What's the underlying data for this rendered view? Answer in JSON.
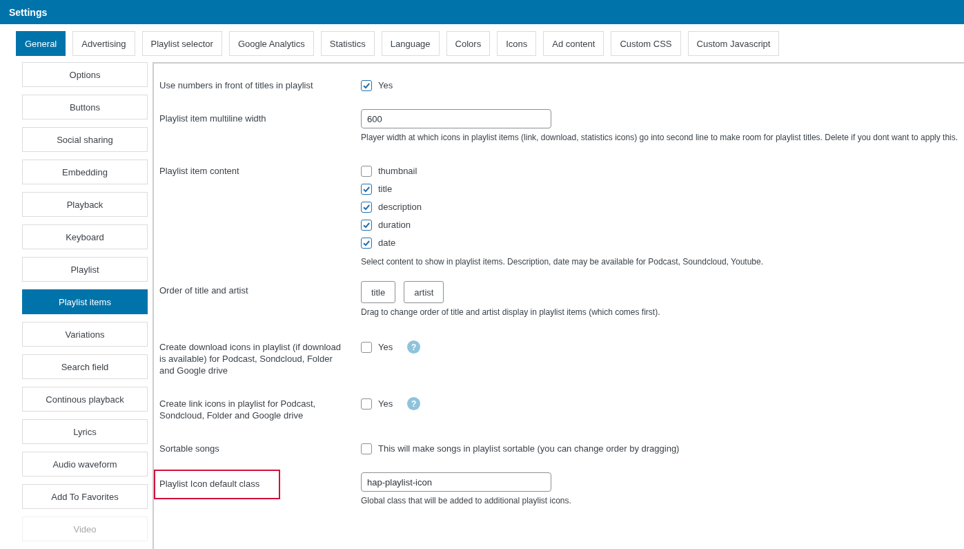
{
  "window": {
    "title": "Settings"
  },
  "tabs": [
    {
      "label": "General",
      "selected": true
    },
    {
      "label": "Advertising",
      "selected": false
    },
    {
      "label": "Playlist selector",
      "selected": false
    },
    {
      "label": "Google Analytics",
      "selected": false
    },
    {
      "label": "Statistics",
      "selected": false
    },
    {
      "label": "Language",
      "selected": false
    },
    {
      "label": "Colors",
      "selected": false
    },
    {
      "label": "Icons",
      "selected": false
    },
    {
      "label": "Ad content",
      "selected": false
    },
    {
      "label": "Custom CSS",
      "selected": false
    },
    {
      "label": "Custom Javascript",
      "selected": false
    }
  ],
  "sidebar": {
    "items": [
      {
        "label": "Options",
        "selected": false,
        "disabled": false
      },
      {
        "label": "Buttons",
        "selected": false,
        "disabled": false
      },
      {
        "label": "Social sharing",
        "selected": false,
        "disabled": false
      },
      {
        "label": "Embedding",
        "selected": false,
        "disabled": false
      },
      {
        "label": "Playback",
        "selected": false,
        "disabled": false
      },
      {
        "label": "Keyboard",
        "selected": false,
        "disabled": false
      },
      {
        "label": "Playlist",
        "selected": false,
        "disabled": false
      },
      {
        "label": "Playlist items",
        "selected": true,
        "disabled": false
      },
      {
        "label": "Variations",
        "selected": false,
        "disabled": false
      },
      {
        "label": "Search field",
        "selected": false,
        "disabled": false
      },
      {
        "label": "Continous playback",
        "selected": false,
        "disabled": false
      },
      {
        "label": "Lyrics",
        "selected": false,
        "disabled": false
      },
      {
        "label": "Audio waveform",
        "selected": false,
        "disabled": false
      },
      {
        "label": "Add To Favorites",
        "selected": false,
        "disabled": false
      },
      {
        "label": "Video",
        "selected": false,
        "disabled": true
      }
    ]
  },
  "settings": [
    {
      "kind": "checkbox",
      "label": "Use numbers in front of titles in playlist",
      "highlighted": false,
      "options": [
        {
          "label": "Yes",
          "checked": true
        }
      ]
    },
    {
      "kind": "text",
      "label": "Playlist item multiline width",
      "highlighted": false,
      "value": "600",
      "hint": "Player width at which icons in playlist items (link, download, statistics icons) go into second line to make room for playlist titles. Delete if you dont want to apply this."
    },
    {
      "kind": "checkbox",
      "label": "Playlist item content",
      "highlighted": false,
      "options": [
        {
          "label": "thumbnail",
          "checked": false
        },
        {
          "label": "title",
          "checked": true
        },
        {
          "label": "description",
          "checked": true
        },
        {
          "label": "duration",
          "checked": true
        },
        {
          "label": "date",
          "checked": true
        }
      ],
      "hint": "Select content to show in playlist items. Description, date may be available for Podcast, Soundcloud, Youtube."
    },
    {
      "kind": "order",
      "label": "Order of title and artist",
      "highlighted": false,
      "items": [
        "title",
        "artist"
      ],
      "hint": "Drag to change order of title and artist display in playlist items (which comes first)."
    },
    {
      "kind": "checkbox",
      "label": "Create download icons in playlist (if download is available) for Podcast, Sondcloud, Folder and Google drive",
      "highlighted": false,
      "help": "?",
      "options": [
        {
          "label": "Yes",
          "checked": false
        }
      ]
    },
    {
      "kind": "checkbox",
      "label": "Create link icons in playlist for Podcast, Sondcloud, Folder and Google drive",
      "highlighted": false,
      "help": "?",
      "options": [
        {
          "label": "Yes",
          "checked": false
        }
      ]
    },
    {
      "kind": "checkbox",
      "label": "Sortable songs",
      "highlighted": false,
      "options": [
        {
          "label": "This will make songs in playlist sortable (you can change order by dragging)",
          "checked": false
        }
      ]
    },
    {
      "kind": "text",
      "label": "Playlist Icon default class",
      "highlighted": true,
      "value": "hap-playlist-icon",
      "hint": "Global class that will be added to additional playlist icons."
    }
  ]
}
